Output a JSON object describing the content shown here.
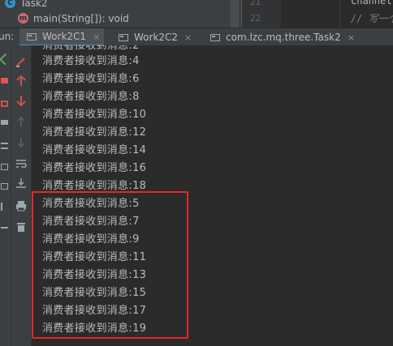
{
  "structure": {
    "class_name": "Task2",
    "method_signature": "main(String[]): void",
    "class_icon": "class-icon",
    "method_icon": "method-icon"
  },
  "gutter": {
    "lines": [
      "21",
      "22"
    ]
  },
  "editor": {
    "line1": "channel.",
    "line2": "// 写一个"
  },
  "run": {
    "label": "un:",
    "tabs": [
      {
        "label": "Work2C1",
        "close": "×",
        "active": true
      },
      {
        "label": "Work2C2",
        "close": "×",
        "active": false
      },
      {
        "label": "com.lzc.mq.three.Task2",
        "close": "×",
        "active": false
      }
    ]
  },
  "toolbar": {
    "icons": [
      "wrench-icon",
      "up-arrow-icon",
      "down-arrow-icon",
      "up-nav-icon",
      "down-nav-icon",
      "soft-wrap-icon",
      "scroll-end-icon",
      "print-icon",
      "trash-icon"
    ]
  },
  "console": {
    "lines": [
      "消费者接收到消息:2",
      "消费者接收到消息:4",
      "消费者接收到消息:6",
      "消费者接收到消息:8",
      "消费者接收到消息:10",
      "消费者接收到消息:12",
      "消费者接收到消息:14",
      "消费者接收到消息:16",
      "消费者接收到消息:18",
      "消费者接收到消息:5",
      "消费者接收到消息:7",
      "消费者接收到消息:9",
      "消费者接收到消息:11",
      "消费者接收到消息:13",
      "消费者接收到消息:15",
      "消费者接收到消息:17",
      "消费者接收到消息:19"
    ],
    "highlight_color": "#e6282b"
  }
}
